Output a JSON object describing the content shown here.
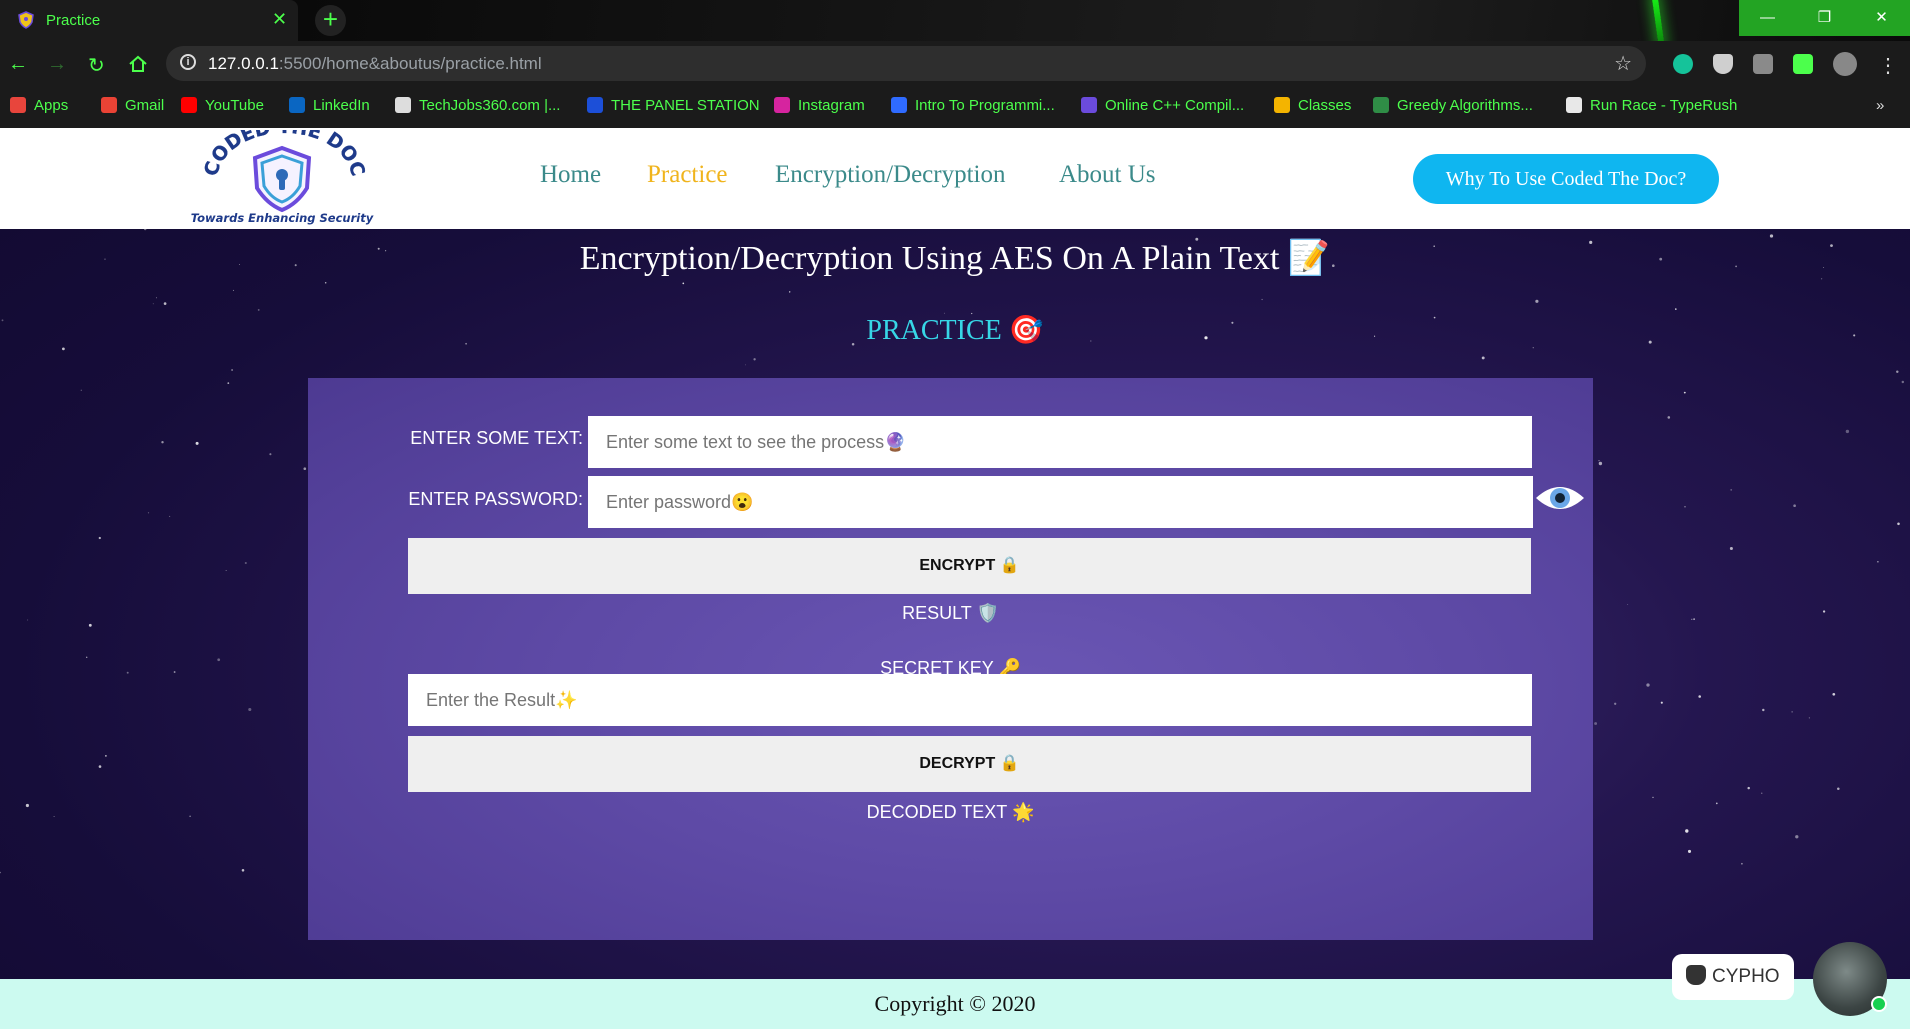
{
  "browser": {
    "tab_title": "Practice",
    "url_host": "127.0.0.1",
    "url_rest": ":5500/home&aboutus/practice.html",
    "bookmarks": [
      {
        "label": "Apps",
        "icon": "apps-grid-icon",
        "color": "#e8453c"
      },
      {
        "label": "Gmail",
        "icon": "gmail-icon",
        "color": "#ea4335"
      },
      {
        "label": "YouTube",
        "icon": "youtube-icon",
        "color": "#ff0000"
      },
      {
        "label": "LinkedIn",
        "icon": "linkedin-icon",
        "color": "#0a66c2"
      },
      {
        "label": "TechJobs360.com |...",
        "icon": "wordpress-icon",
        "color": "#dddddd"
      },
      {
        "label": "THE PANEL STATION",
        "icon": "tps-icon",
        "color": "#1c4fd8"
      },
      {
        "label": "Instagram",
        "icon": "instagram-icon",
        "color": "#d6249f"
      },
      {
        "label": "Intro To Programmi...",
        "icon": "course-icon",
        "color": "#2f6bff"
      },
      {
        "label": "Online C++ Compil...",
        "icon": "compiler-icon",
        "color": "#6b4bdc"
      },
      {
        "label": "Classes",
        "icon": "classroom-icon",
        "color": "#f4b400"
      },
      {
        "label": "Greedy Algorithms...",
        "icon": "gfg-icon",
        "color": "#2f8d46"
      },
      {
        "label": "Run Race - TypeRush",
        "icon": "typerush-icon",
        "color": "#e8e8e8"
      }
    ]
  },
  "site": {
    "logo_title": "CODED THE DOC",
    "logo_tagline": "Towards Enhancing Security",
    "nav": [
      "Home",
      "Practice",
      "Encryption/Decryption",
      "About Us"
    ],
    "cta": "Why To Use Coded The Doc?"
  },
  "main": {
    "heading": "Encryption/Decryption Using AES On A Plain Text 📝",
    "subheading": "PRACTICE 🎯",
    "text_label": "ENTER SOME TEXT:",
    "text_placeholder": "Enter some text to see the process🔮",
    "password_label": "ENTER PASSWORD:",
    "password_placeholder": "Enter password😮",
    "encrypt_button": "ENCRYPT 🔒",
    "result_label": "RESULT 🛡️",
    "secret_key_label": "SECRET KEY 🔑",
    "result_placeholder": "Enter the Result✨",
    "decrypt_button": "DECRYPT 🔒",
    "decoded_label": "DECODED TEXT 🌟"
  },
  "footer": {
    "copyright": "Copyright © 2020"
  },
  "chatbot": {
    "label": "CYPHO"
  },
  "colors": {
    "accent_nav": "#3b8a8a",
    "active_nav": "#f0b41c",
    "cta_bg": "#0fb6f0",
    "practice_heading": "#37d6e6",
    "panel_bg": "#5e4aa6",
    "footer_bg": "#ccfaf0",
    "browser_accent": "#4cff4c"
  }
}
